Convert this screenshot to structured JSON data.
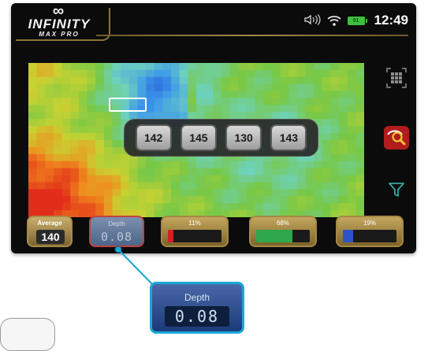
{
  "header": {
    "logo_symbol": "∞",
    "logo_title": "INFINITY",
    "logo_subtitle": "MAX PRO"
  },
  "status_bar": {
    "battery_level": "91",
    "time": "12:49",
    "icons": [
      "speaker-icon",
      "wifi-icon",
      "battery-icon"
    ]
  },
  "scan": {
    "readings": [
      "142",
      "145",
      "130",
      "143"
    ]
  },
  "side_buttons": {
    "icons": [
      "grid-view-icon",
      "search-zoom-icon",
      "filter-icon"
    ]
  },
  "bottom_bar": {
    "average_label": "Average",
    "average_value": "140",
    "depth_label": "Depth",
    "depth_value": "0.08",
    "bars": [
      {
        "label": "11%",
        "fraction": 0.11,
        "color": "#d81e1e"
      },
      {
        "label": "68%",
        "fraction": 0.68,
        "color": "#2ea84a"
      },
      {
        "label": "19%",
        "fraction": 0.19,
        "color": "#2d54c8"
      }
    ]
  },
  "callout": {
    "label": "Depth",
    "value": "0.08"
  },
  "colors": {
    "gold": "#a98c48",
    "accent_red": "#b11c1c",
    "callout_border": "#19a8d6"
  }
}
